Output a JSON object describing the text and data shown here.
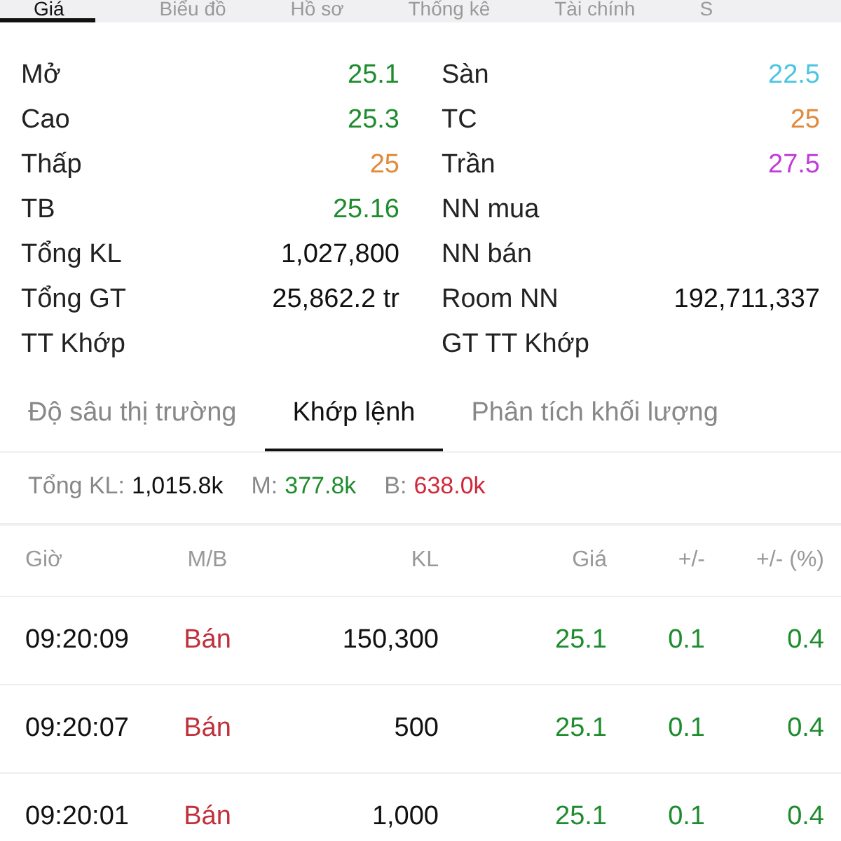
{
  "top_tabs": [
    {
      "label": "Giá",
      "selected": true
    },
    {
      "label": "Biểu đồ",
      "selected": false
    },
    {
      "label": "Hồ sơ",
      "selected": false
    },
    {
      "label": "Thống kê",
      "selected": false
    },
    {
      "label": "Tài chính",
      "selected": false
    },
    {
      "label": "S",
      "selected": false
    }
  ],
  "stats_left": [
    {
      "label": "Mở",
      "value": "25.1",
      "color": "#1e8c2e"
    },
    {
      "label": "Cao",
      "value": "25.3",
      "color": "#1e8c2e"
    },
    {
      "label": "Thấp",
      "value": "25",
      "color": "#e08a3c"
    },
    {
      "label": "TB",
      "value": "25.16",
      "color": "#1e8c2e"
    },
    {
      "label": "Tổng KL",
      "value": "1,027,800",
      "color": "#111111"
    },
    {
      "label": "Tổng GT",
      "value": "25,862.2 tr",
      "color": "#111111"
    },
    {
      "label": "TT Khớp"
    }
  ],
  "stats_right": [
    {
      "label": "Sàn",
      "value": "22.5",
      "color": "#4cc6e0"
    },
    {
      "label": "TC",
      "value": "25",
      "color": "#e08a3c"
    },
    {
      "label": "Trần",
      "value": "27.5",
      "color": "#c03cd8"
    },
    {
      "label": "NN mua"
    },
    {
      "label": "NN bán"
    },
    {
      "label": "Room NN",
      "value": "192,711,337",
      "color": "#111111"
    },
    {
      "label": "GT TT Khớp"
    }
  ],
  "sub_tabs": [
    {
      "label": "Độ sâu thị trường",
      "selected": false
    },
    {
      "label": "Khớp lệnh",
      "selected": true
    },
    {
      "label": "Phân tích khối lượng",
      "selected": false
    }
  ],
  "summary": [
    {
      "label": "Tổng KL:",
      "value": "1,015.8k",
      "color": "#111111"
    },
    {
      "label": "M:",
      "value": "377.8k",
      "color": "#1e8c2e"
    },
    {
      "label": "B:",
      "value": "638.0k",
      "color": "#d0283a"
    }
  ],
  "table": {
    "columns": [
      "Giờ",
      "M/B",
      "KL",
      "Giá",
      "+/-",
      "+/- (%)"
    ],
    "rows": [
      {
        "cells": [
          "09:20:09",
          "Bán",
          "150,300",
          "25.1",
          "0.1",
          "0.4"
        ]
      },
      {
        "cells": [
          "09:20:07",
          "Bán",
          "500",
          "25.1",
          "0.1",
          "0.4"
        ]
      },
      {
        "cells": [
          "09:20:01",
          "Bán",
          "1,000",
          "25.1",
          "0.1",
          "0.4"
        ]
      }
    ]
  }
}
